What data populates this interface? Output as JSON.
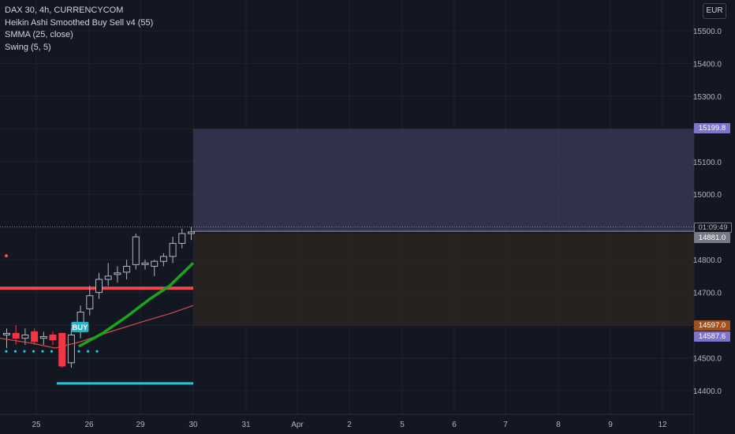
{
  "legend": {
    "symbol": "DAX 30, 4h, CURRENCYCOM",
    "indicator1": "Heikin Ashi Smoothed Buy Sell v4  (55)",
    "indicator2": "SMMA (25, close)",
    "indicator3": "Swing (5, 5)"
  },
  "currency_button": "EUR",
  "price_labels": {
    "upper_zone": "15199.8",
    "countdown": "01:09:49",
    "last_price": "14881.0",
    "lower_zone_a": "14597.0",
    "lower_zone_b": "14587.6"
  },
  "buy_label": "BUY",
  "colors": {
    "background": "#131722",
    "up_candle_border": "#b2b5be",
    "down_candle": "#f23645",
    "smma_line": "#1aa61a",
    "red_line": "#d64a4a",
    "swing_line": "#f0484f",
    "swing_dots": "#26c6da",
    "upper_zone": "#3b3856",
    "lower_zone": "#2a221f",
    "upper_tag": "#7e75c8",
    "lower_tag_a": "#a0521e",
    "lower_tag_b": "#7e75c8",
    "last_tag": "#787b86"
  },
  "chart_data": {
    "type": "candlestick",
    "yticks": [
      14400,
      14500,
      14600,
      14700,
      14800,
      14900,
      15000,
      15100,
      15200,
      15300,
      15400,
      15500
    ],
    "ytick_labels": [
      "14400.0",
      "14500.0",
      "14600.0",
      "14700.0",
      "14800.0",
      "14900.0",
      "15000.0",
      "15100.0",
      "15200.0",
      "15300.0",
      "15400.0",
      "15500.0"
    ],
    "x_labels": [
      "25",
      "26",
      "29",
      "30",
      "31",
      "Apr",
      "2",
      "5",
      "6",
      "7",
      "8",
      "9",
      "12"
    ],
    "candles": [
      {
        "o": 14570,
        "h": 14590,
        "l": 14530,
        "c": 14575
      },
      {
        "o": 14575,
        "h": 14600,
        "l": 14540,
        "c": 14560
      },
      {
        "o": 14560,
        "h": 14590,
        "l": 14540,
        "c": 14570
      },
      {
        "o": 14580,
        "h": 14590,
        "l": 14540,
        "c": 14550
      },
      {
        "o": 14560,
        "h": 14580,
        "l": 14540,
        "c": 14565
      },
      {
        "o": 14570,
        "h": 14580,
        "l": 14540,
        "c": 14555
      },
      {
        "o": 14575,
        "h": 14575,
        "l": 14470,
        "c": 14475
      },
      {
        "o": 14485,
        "h": 14590,
        "l": 14470,
        "c": 14570
      },
      {
        "o": 14580,
        "h": 14660,
        "l": 14560,
        "c": 14640
      },
      {
        "o": 14650,
        "h": 14720,
        "l": 14630,
        "c": 14690
      },
      {
        "o": 14700,
        "h": 14760,
        "l": 14680,
        "c": 14740
      },
      {
        "o": 14740,
        "h": 14790,
        "l": 14720,
        "c": 14750
      },
      {
        "o": 14755,
        "h": 14780,
        "l": 14730,
        "c": 14760
      },
      {
        "o": 14762,
        "h": 14800,
        "l": 14740,
        "c": 14780
      },
      {
        "o": 14785,
        "h": 14880,
        "l": 14770,
        "c": 14870
      },
      {
        "o": 14785,
        "h": 14800,
        "l": 14770,
        "c": 14790
      },
      {
        "o": 14780,
        "h": 14800,
        "l": 14750,
        "c": 14795
      },
      {
        "o": 14795,
        "h": 14820,
        "l": 14780,
        "c": 14810
      },
      {
        "o": 14810,
        "h": 14870,
        "l": 14790,
        "c": 14850
      },
      {
        "o": 14850,
        "h": 14895,
        "l": 14835,
        "c": 14880
      },
      {
        "o": 14880,
        "h": 14900,
        "l": 14860,
        "c": 14885
      }
    ],
    "buy_signal_index": 7,
    "zones": [
      {
        "from": 14887,
        "to": 15199.8
      },
      {
        "from": 14597,
        "to": 14881
      }
    ],
    "red_horizontal_level": 14713,
    "swing_low_level": 14422,
    "current_price": 14881
  }
}
